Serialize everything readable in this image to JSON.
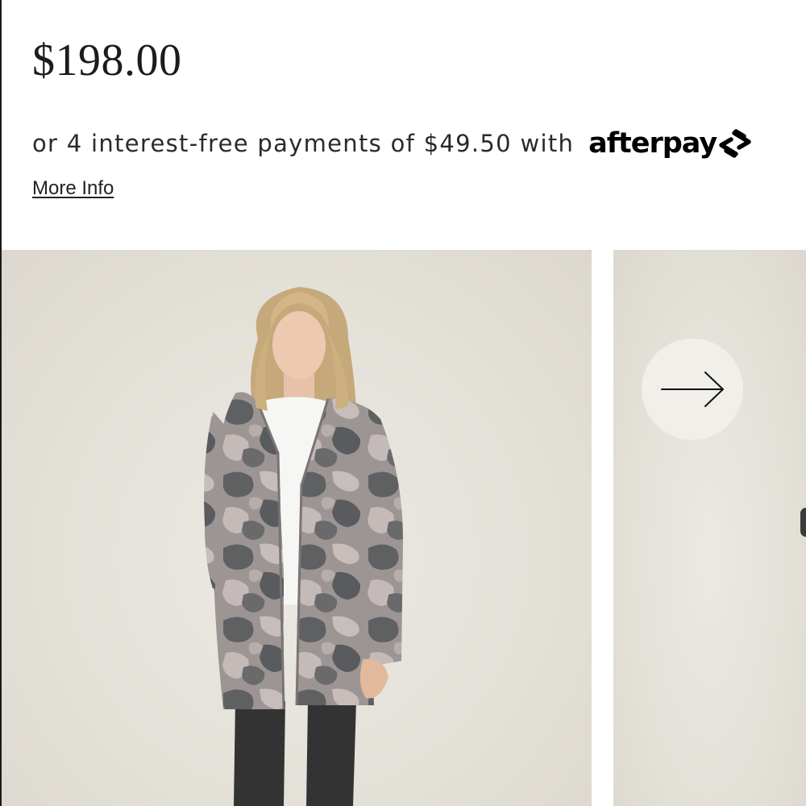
{
  "product": {
    "price": "$198.00"
  },
  "afterpay": {
    "installment_text": "or 4 interest-free payments of $49.50 with",
    "brand_name": "afterpay",
    "brand_icon": "afterpay-arrows-icon",
    "more_info_label": "More Info"
  },
  "gallery": {
    "main_image": "model-camo-hooded-cardigan-photo",
    "next_button_icon": "arrow-right-icon"
  },
  "colors": {
    "price_text": "#1c1c1c",
    "background": "#ffffff",
    "photo_backdrop": "#e4e1d9",
    "next_button_bg": "#f1efea"
  }
}
